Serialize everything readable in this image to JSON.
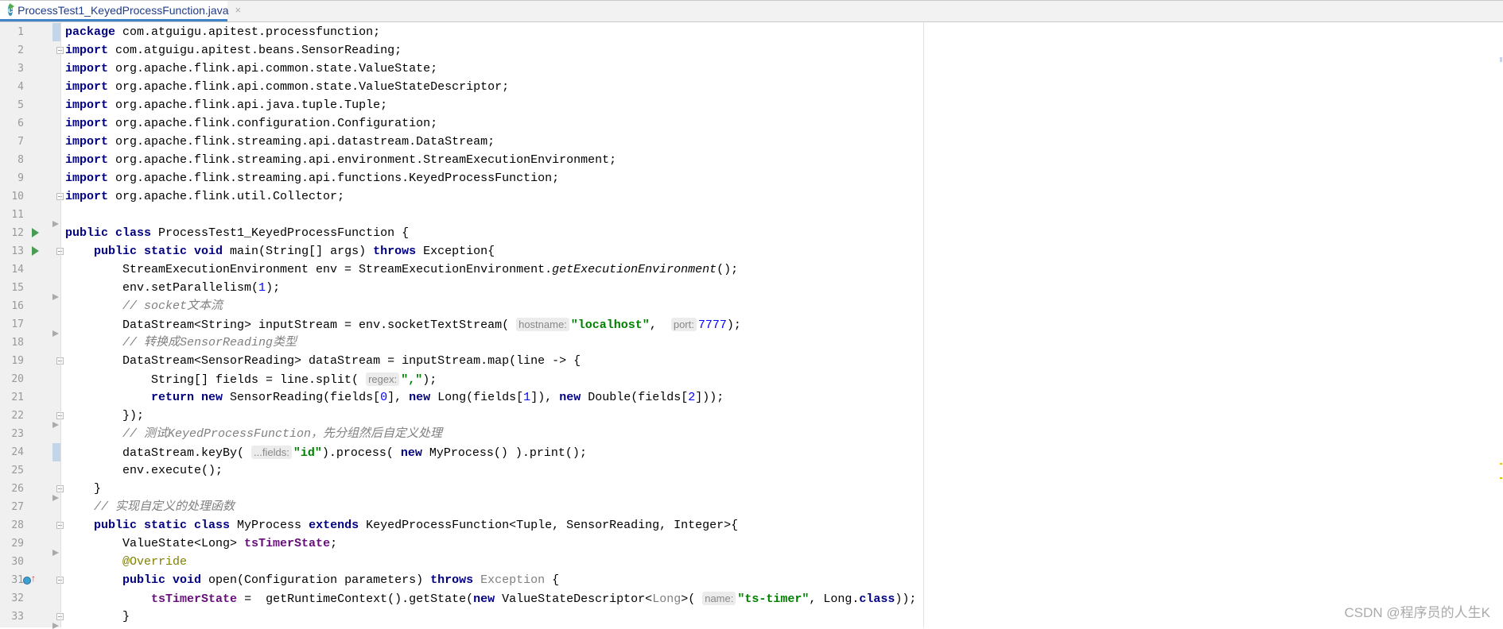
{
  "tab": {
    "label": "ProcessTest1_KeyedProcessFunction.java",
    "icon_letter": "c",
    "close": "×"
  },
  "watermark": "CSDN @程序员的人生K",
  "colors": {
    "keyword": "#000080",
    "string": "#008000",
    "number": "#0000ff",
    "comment": "#808080",
    "field": "#660e7a",
    "annotation": "#808000",
    "tab_accent": "#4083c9"
  },
  "gutter": {
    "run_icon_lines": [
      12,
      13
    ],
    "override_icon_lines": [
      31
    ],
    "fold_lines": [
      2,
      10,
      13,
      19,
      22,
      26,
      28,
      31,
      33
    ],
    "current_line_markers": [
      1,
      24
    ]
  },
  "lines": [
    [
      [
        "kw",
        "package"
      ],
      [
        "pl",
        " com.atguigu.apitest.processfunction;"
      ]
    ],
    [
      [
        "kw",
        "import"
      ],
      [
        "pl",
        " com.atguigu.apitest.beans.SensorReading;"
      ]
    ],
    [
      [
        "kw",
        "import"
      ],
      [
        "pl",
        " org.apache.flink.api.common.state.ValueState;"
      ]
    ],
    [
      [
        "kw",
        "import"
      ],
      [
        "pl",
        " org.apache.flink.api.common.state.ValueStateDescriptor;"
      ]
    ],
    [
      [
        "kw",
        "import"
      ],
      [
        "pl",
        " org.apache.flink.api.java.tuple.Tuple;"
      ]
    ],
    [
      [
        "kw",
        "import"
      ],
      [
        "pl",
        " org.apache.flink.configuration.Configuration;"
      ]
    ],
    [
      [
        "kw",
        "import"
      ],
      [
        "pl",
        " org.apache.flink.streaming.api.datastream.DataStream;"
      ]
    ],
    [
      [
        "kw",
        "import"
      ],
      [
        "pl",
        " org.apache.flink.streaming.api.environment.StreamExecutionEnvironment;"
      ]
    ],
    [
      [
        "kw",
        "import"
      ],
      [
        "pl",
        " org.apache.flink.streaming.api.functions.KeyedProcessFunction;"
      ]
    ],
    [
      [
        "kw",
        "import"
      ],
      [
        "pl",
        " org.apache.flink.util.Collector;"
      ]
    ],
    [],
    [
      [
        "kw",
        "public class"
      ],
      [
        "pl",
        " ProcessTest1_KeyedProcessFunction {"
      ]
    ],
    [
      [
        "pl",
        "    "
      ],
      [
        "kw",
        "public static void"
      ],
      [
        "pl",
        " main(String[] args) "
      ],
      [
        "kw",
        "throws"
      ],
      [
        "pl",
        " Exception{"
      ]
    ],
    [
      [
        "pl",
        "        StreamExecutionEnvironment env = StreamExecutionEnvironment."
      ],
      [
        "sm",
        "getExecutionEnvironment"
      ],
      [
        "pl",
        "();"
      ]
    ],
    [
      [
        "pl",
        "        env.setParallelism("
      ],
      [
        "num",
        "1"
      ],
      [
        "pl",
        ");"
      ]
    ],
    [
      [
        "pl",
        "        "
      ],
      [
        "cm",
        "// socket文本流"
      ]
    ],
    [
      [
        "pl",
        "        DataStream<String> inputStream = env.socketTextStream( "
      ],
      [
        "hint",
        "hostname:"
      ],
      [
        "str",
        "\"localhost\""
      ],
      [
        "pl",
        ",  "
      ],
      [
        "hint",
        "port:"
      ],
      [
        "num",
        "7777"
      ],
      [
        "pl",
        ");"
      ]
    ],
    [
      [
        "pl",
        "        "
      ],
      [
        "cm",
        "// 转换成SensorReading类型"
      ]
    ],
    [
      [
        "pl",
        "        DataStream<SensorReading> dataStream = inputStream.map(line -> {"
      ]
    ],
    [
      [
        "pl",
        "            String[] fields = line.split( "
      ],
      [
        "hint",
        "regex:"
      ],
      [
        "str",
        "\",\""
      ],
      [
        "pl",
        ");"
      ]
    ],
    [
      [
        "pl",
        "            "
      ],
      [
        "kw",
        "return new"
      ],
      [
        "pl",
        " SensorReading(fields["
      ],
      [
        "num",
        "0"
      ],
      [
        "pl",
        "], "
      ],
      [
        "kw",
        "new"
      ],
      [
        "pl",
        " Long(fields["
      ],
      [
        "num",
        "1"
      ],
      [
        "pl",
        "]), "
      ],
      [
        "kw",
        "new"
      ],
      [
        "pl",
        " Double(fields["
      ],
      [
        "num",
        "2"
      ],
      [
        "pl",
        "]));"
      ]
    ],
    [
      [
        "pl",
        "        });"
      ]
    ],
    [
      [
        "pl",
        "        "
      ],
      [
        "cm",
        "// 测试KeyedProcessFunction，先分组然后自定义处理"
      ]
    ],
    [
      [
        "pl",
        "        dataStream.keyBy( "
      ],
      [
        "hint",
        "...fields:"
      ],
      [
        "str",
        "\"id\""
      ],
      [
        "pl",
        ").process( "
      ],
      [
        "kw",
        "new"
      ],
      [
        "pl",
        " MyProcess() ).print();"
      ]
    ],
    [
      [
        "pl",
        "        env.execute();"
      ]
    ],
    [
      [
        "pl",
        "    }"
      ]
    ],
    [
      [
        "pl",
        "    "
      ],
      [
        "cm",
        "// 实现自定义的处理函数"
      ]
    ],
    [
      [
        "pl",
        "    "
      ],
      [
        "kw",
        "public static class"
      ],
      [
        "pl",
        " MyProcess "
      ],
      [
        "kw",
        "extends"
      ],
      [
        "pl",
        " KeyedProcessFunction<Tuple, SensorReading, Integer>{"
      ]
    ],
    [
      [
        "pl",
        "        ValueState<Long> "
      ],
      [
        "fld",
        "tsTimerState"
      ],
      [
        "pl",
        ";"
      ]
    ],
    [
      [
        "pl",
        "        "
      ],
      [
        "ann",
        "@Override"
      ]
    ],
    [
      [
        "pl",
        "        "
      ],
      [
        "kw",
        "public void"
      ],
      [
        "pl",
        " open(Configuration parameters) "
      ],
      [
        "kw",
        "throws"
      ],
      [
        "pl",
        " "
      ],
      [
        "dim",
        "Exception"
      ],
      [
        "pl",
        " {"
      ]
    ],
    [
      [
        "pl",
        "            "
      ],
      [
        "fld",
        "tsTimerState"
      ],
      [
        "pl",
        " =  getRuntimeContext().getState("
      ],
      [
        "kw",
        "new"
      ],
      [
        "pl",
        " ValueStateDescriptor<"
      ],
      [
        "dim",
        "Long"
      ],
      [
        "pl",
        ">( "
      ],
      [
        "hint",
        "name:"
      ],
      [
        "str",
        "\"ts-timer\""
      ],
      [
        "pl",
        ", Long."
      ],
      [
        "kw",
        "class"
      ],
      [
        "pl",
        "));"
      ]
    ],
    [
      [
        "pl",
        "        }"
      ]
    ]
  ]
}
